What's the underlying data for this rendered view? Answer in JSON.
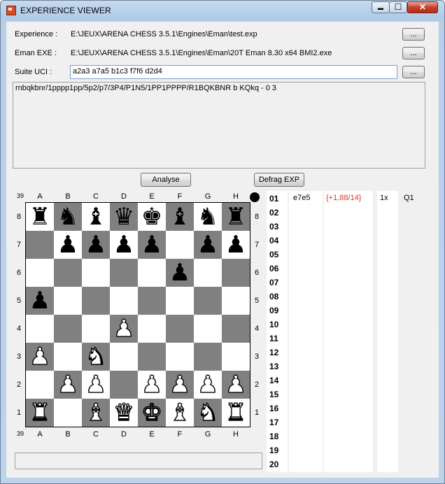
{
  "window": {
    "title": "EXPERIENCE VIEWER",
    "min_glyph": "▬",
    "max_glyph": "☐",
    "close_glyph": "✕"
  },
  "fields": {
    "experience": {
      "label": "Experience :",
      "value": "E:\\JEUX\\ARENA CHESS 3.5.1\\Engines\\Eman\\test.exp",
      "button": "..."
    },
    "eman_exe": {
      "label": "Eman EXE :",
      "value": "E:\\JEUX\\ARENA CHESS 3.5.1\\Engines\\Eman\\20T Eman 8.30 x64 BMI2.exe",
      "button": "..."
    },
    "suite_uci": {
      "label": "Suite UCI :",
      "value": "a2a3 a7a5 b1c3 f7f6 d2d4",
      "button": "..."
    }
  },
  "fen": "rnbqkbnr/1pppp1pp/5p2/p7/3P4/P1N5/1PP1PPPP/R1BQKBNR b KQkq - 0 3",
  "buttons": {
    "analyse": "Analyse",
    "defrag": "Defrag EXP"
  },
  "board": {
    "corner_top": "39",
    "corner_bottom": "39",
    "files": [
      "A",
      "B",
      "C",
      "D",
      "E",
      "F",
      "G",
      "H"
    ],
    "ranks": [
      "8",
      "7",
      "6",
      "5",
      "4",
      "3",
      "2",
      "1"
    ],
    "position": [
      [
        "br",
        "bn",
        "bb",
        "bq",
        "bk",
        "bb",
        "bn",
        "br"
      ],
      [
        "",
        "bp",
        "bp",
        "bp",
        "bp",
        "",
        "bp",
        "bp"
      ],
      [
        "",
        "",
        "",
        "",
        "",
        "bp",
        "",
        ""
      ],
      [
        "bp",
        "",
        "",
        "",
        "",
        "",
        "",
        ""
      ],
      [
        "",
        "",
        "",
        "wp",
        "",
        "",
        "",
        ""
      ],
      [
        "wp",
        "",
        "wn",
        "",
        "",
        "",
        "",
        ""
      ],
      [
        "",
        "wp",
        "wp",
        "",
        "wp",
        "wp",
        "wp",
        "wp"
      ],
      [
        "wr",
        "",
        "wb",
        "wq",
        "wk",
        "wb",
        "wn",
        "wr"
      ]
    ],
    "side_to_move": "black"
  },
  "moves": {
    "numbers": [
      "01",
      "02",
      "03",
      "04",
      "05",
      "06",
      "07",
      "08",
      "09",
      "10",
      "11",
      "12",
      "13",
      "14",
      "15",
      "16",
      "17",
      "18",
      "19",
      "20"
    ],
    "rows": [
      {
        "move": "e7e5",
        "score": "{+1,88/14}",
        "count": "1x",
        "quality": "Q1"
      }
    ],
    "score_color": "#e0312c"
  }
}
